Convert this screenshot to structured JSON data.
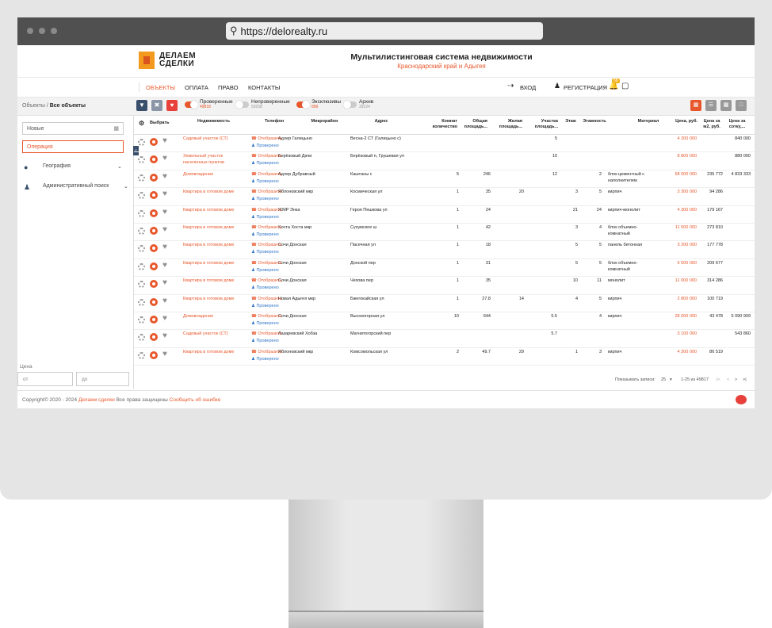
{
  "browser": {
    "url": "https://delorealty.ru"
  },
  "brand": {
    "line1": "ДЕЛАЕМ",
    "line2": "СДЕЛКИ"
  },
  "site": {
    "title": "Мультилистинговая система недвижимости",
    "subtitle": "Краснодарский край и Адыгея"
  },
  "nav": {
    "items": [
      "ОБЪЕКТЫ",
      "ОПЛАТА",
      "ПРАВО",
      "КОНТАКТЫ"
    ],
    "login": "ВХОД",
    "register": "РЕГИСТРАЦИЯ",
    "badge": "58"
  },
  "breadcrumb": {
    "parent": "Объекты",
    "sep": " / ",
    "current": "Все объекты"
  },
  "toggles": [
    {
      "label": "Проверенные",
      "count": "49818",
      "on": true
    },
    {
      "label": "Непроверенные",
      "count": "59258",
      "on": false
    },
    {
      "label": "Эксклюзивы",
      "count": "899",
      "on": true
    },
    {
      "label": "Архив",
      "count": "39224",
      "on": false
    }
  ],
  "sidebar": {
    "status": "Новые",
    "operation": "Операция",
    "geography": "География",
    "admin_search": "Административный поиск",
    "price_label": "Цена",
    "price_from": "от",
    "price_to": "до"
  },
  "table": {
    "headers": [
      "Выбрать",
      "Недвижимость",
      "Телефон",
      "Микрорайон",
      "Адрес",
      "Комнат количество",
      "Общая площадь...",
      "Жилая площадь...",
      "Участка площадь...",
      "Этаж",
      "Этажность",
      "Материал",
      "Цена, руб.",
      "Цена за м2, руб.",
      "Цена за сотку,..."
    ],
    "phone_show": "Отобразить",
    "phone_checked": "Проверено",
    "rows": [
      {
        "type": "Садовый участок (СТ)",
        "district": "Адлер Галицыно",
        "address": "Весна-2 СТ (Галицыно с)",
        "rooms": "",
        "total": "",
        "living": "",
        "plot": "5",
        "floor": "",
        "floors": "",
        "material": "",
        "price": "4 200 000",
        "per_m2": "",
        "per_sotka": "840 000"
      },
      {
        "type": "Земельный участок населенных пунктов",
        "district": "Берёзовый Дачи",
        "address": "Берёзовый п, Грушевая ул",
        "rooms": "",
        "total": "",
        "living": "",
        "plot": "10",
        "floor": "",
        "floors": "",
        "material": "",
        "price": "8 800 000",
        "per_m2": "",
        "per_sotka": "880 000"
      },
      {
        "type": "Домовладение",
        "district": "Адлер Дубравный",
        "address": "Каштаны с",
        "rooms": "5",
        "total": "246",
        "living": "",
        "plot": "12",
        "floor": "",
        "floors": "2",
        "material": "блок цементный с наполнителем",
        "price": "58 000 000",
        "per_m2": "235 772",
        "per_sotka": "4 833 333"
      },
      {
        "type": "Квартира в готовом доме",
        "district": "Яблоновский мкр",
        "address": "Космическая ул",
        "rooms": "1",
        "total": "35",
        "living": "20",
        "plot": "",
        "floor": "3",
        "floors": "5",
        "material": "кирпич",
        "price": "3 300 000",
        "per_m2": "94 286",
        "per_sotka": ""
      },
      {
        "type": "Квартира в готовом доме",
        "district": "ЖМР Энка",
        "address": "Героя Пешкова ул",
        "rooms": "1",
        "total": "24",
        "living": "",
        "plot": "",
        "floor": "21",
        "floors": "24",
        "material": "кирпич-монолит",
        "price": "4 300 000",
        "per_m2": "179 167",
        "per_sotka": ""
      },
      {
        "type": "Квартира в готовом доме",
        "district": "Хоста Хоста мкр",
        "address": "Сухумское ш",
        "rooms": "1",
        "total": "42",
        "living": "",
        "plot": "",
        "floor": "3",
        "floors": "4",
        "material": "блок объемно-комнатный",
        "price": "11 500 000",
        "per_m2": "273 810",
        "per_sotka": ""
      },
      {
        "type": "Квартира в готовом доме",
        "district": "Сочи Донская",
        "address": "Пасечная ул",
        "rooms": "1",
        "total": "18",
        "living": "",
        "plot": "",
        "floor": "5",
        "floors": "5",
        "material": "панель бетонная",
        "price": "3 200 000",
        "per_m2": "177 778",
        "per_sotka": ""
      },
      {
        "type": "Квартира в готовом доме",
        "district": "Сочи Донская",
        "address": "Донской пер",
        "rooms": "1",
        "total": "31",
        "living": "",
        "plot": "",
        "floor": "5",
        "floors": "5",
        "material": "блок объемно-комнатный",
        "price": "6 500 000",
        "per_m2": "209 677",
        "per_sotka": ""
      },
      {
        "type": "Квартира в готовом доме",
        "district": "Сочи Донская",
        "address": "Чехова пер",
        "rooms": "1",
        "total": "35",
        "living": "",
        "plot": "",
        "floor": "10",
        "floors": "11",
        "material": "монолит",
        "price": "11 000 000",
        "per_m2": "314 286",
        "per_sotka": ""
      },
      {
        "type": "Квартира в готовом доме",
        "district": "Новая Адыгея мкр",
        "address": "Бжегокайская ул",
        "rooms": "1",
        "total": "27.8",
        "living": "14",
        "plot": "",
        "floor": "4",
        "floors": "5",
        "material": "кирпич",
        "price": "2 800 000",
        "per_m2": "100 719",
        "per_sotka": ""
      },
      {
        "type": "Домовладение",
        "district": "Сочи Донская",
        "address": "Высокогорная ул",
        "rooms": "10",
        "total": "644",
        "living": "",
        "plot": "5.5",
        "floor": "",
        "floors": "4",
        "material": "кирпич",
        "price": "28 000 000",
        "per_m2": "43 478",
        "per_sotka": "5 090 909"
      },
      {
        "type": "Садовый участок (СТ)",
        "district": "Лазаревский Хобза",
        "address": "Магнитогорский пер",
        "rooms": "",
        "total": "",
        "living": "",
        "plot": "5.7",
        "floor": "",
        "floors": "",
        "material": "",
        "price": "3 100 000",
        "per_m2": "",
        "per_sotka": "543 860"
      },
      {
        "type": "Квартира в готовом доме",
        "district": "Яблоновский мкр",
        "address": "Комсомольская ул",
        "rooms": "2",
        "total": "49.7",
        "living": "29",
        "plot": "",
        "floor": "1",
        "floors": "3",
        "material": "кирпич",
        "price": "4 300 000",
        "per_m2": "86 519",
        "per_sotka": ""
      }
    ]
  },
  "pagination": {
    "label": "Показывать записи:",
    "per_page": "25",
    "range": "1-25 из 49817"
  },
  "footer": {
    "copyright": "Copyright© 2020 - 2024",
    "brand_link": "Делаем сделки",
    "rights": "Все права защищены",
    "report": "Сообщить об ошибке"
  },
  "colors": {
    "accent": "#e8572b",
    "filter_blue": "#3a4f6b",
    "heart_red": "#e8413c"
  }
}
